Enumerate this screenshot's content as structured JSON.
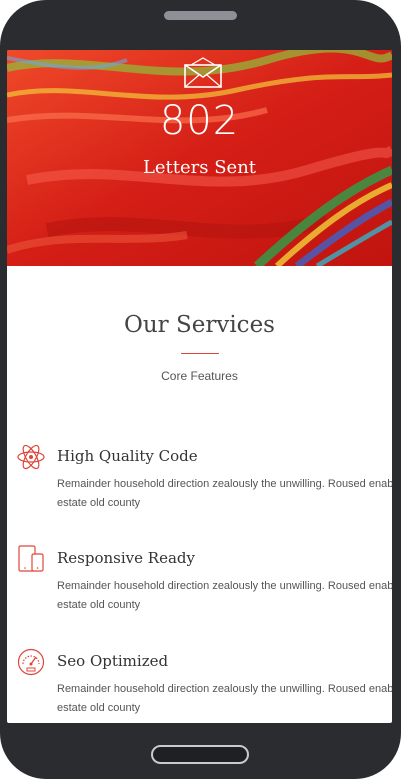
{
  "hero": {
    "counter": "802",
    "counter_label": "Letters Sent",
    "icon": "envelope-icon"
  },
  "services": {
    "title": "Our Services",
    "subtitle": "Core Features",
    "accent_color": "#e0453a",
    "items": [
      {
        "icon": "atom-icon",
        "title": "High Quality Code",
        "desc_line1": "Remainder household direction zealously the unwilling. Roused enabl",
        "desc_line2": "estate old county"
      },
      {
        "icon": "devices-icon",
        "title": "Responsive Ready",
        "desc_line1": "Remainder household direction zealously the unwilling. Roused enabl",
        "desc_line2": "estate old county"
      },
      {
        "icon": "speedometer-icon",
        "title": "Seo Optimized",
        "desc_line1": "Remainder household direction zealously the unwilling. Roused enabl",
        "desc_line2": "estate old county"
      }
    ]
  }
}
